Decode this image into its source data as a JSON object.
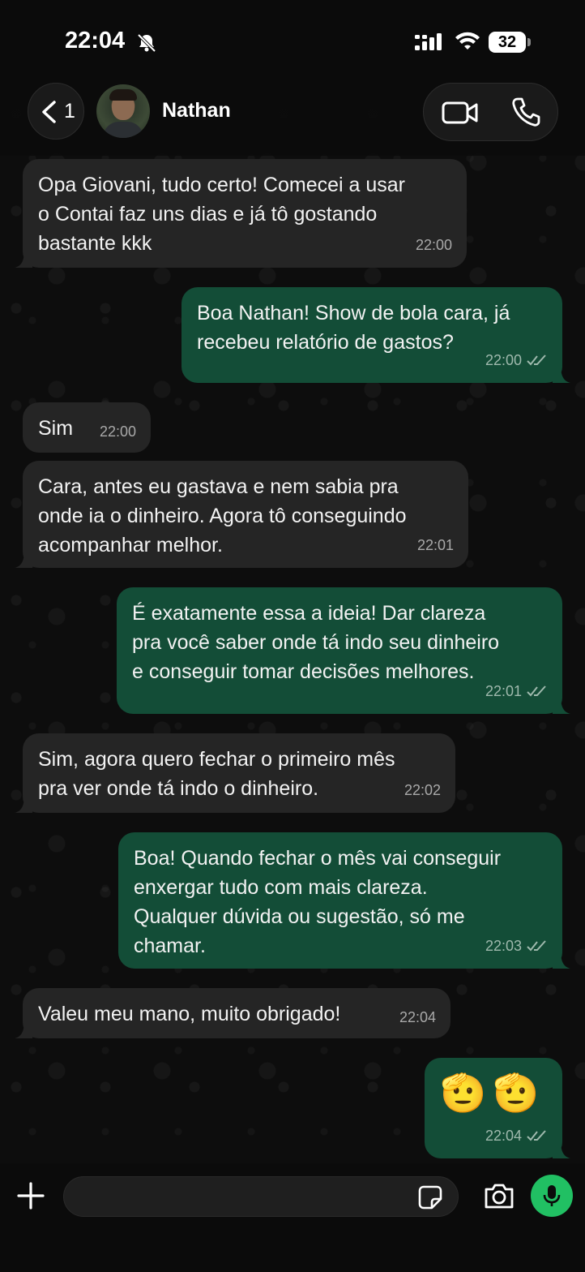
{
  "status_bar": {
    "time": "22:04",
    "battery": "32"
  },
  "header": {
    "back_count": "1",
    "contact_name": "Nathan"
  },
  "messages": [
    {
      "direction": "in",
      "text": "Opa Giovani, tudo certo! Comecei a usar\no Contai faz uns dias e já tô gostando\nbastante kkk",
      "time": "22:00"
    },
    {
      "direction": "out",
      "text": "Boa Nathan! Show de bola cara, já\nrecebeu relatório de gastos?",
      "time": "22:00",
      "read": true
    },
    {
      "direction": "in",
      "text": "Sim",
      "time": "22:00"
    },
    {
      "direction": "in",
      "text": "Cara, antes eu gastava e nem sabia pra\nonde ia o dinheiro. Agora tô conseguindo\nacompanhar melhor.",
      "time": "22:01"
    },
    {
      "direction": "out",
      "text": "É exatamente essa a ideia! Dar clareza\npra você saber onde tá indo seu dinheiro\ne conseguir tomar decisões melhores.",
      "time": "22:01",
      "read": true
    },
    {
      "direction": "in",
      "text": "Sim, agora quero fechar o primeiro mês\npra ver onde tá indo o dinheiro.",
      "time": "22:02"
    },
    {
      "direction": "out",
      "text": "Boa! Quando fechar o mês vai conseguir\nenxergar tudo com mais clareza.\nQualquer dúvida ou sugestão, só me\nchamar.",
      "time": "22:03",
      "read": true
    },
    {
      "direction": "in",
      "text": "Valeu meu mano, muito obrigado!",
      "time": "22:04"
    },
    {
      "direction": "out",
      "text": "🫡🫡",
      "time": "22:04",
      "read": true
    }
  ],
  "composer": {
    "value": "",
    "placeholder": ""
  },
  "colors": {
    "incoming_bubble": "#252525",
    "outgoing_bubble": "#134d37",
    "mic_button": "#21c063",
    "background": "#0b0b0b"
  },
  "icons": [
    "bell-off-icon",
    "signal-icon",
    "wifi-icon",
    "battery-icon",
    "chevron-left-icon",
    "video-call-icon",
    "phone-icon",
    "double-check-icon",
    "plus-icon",
    "sticker-icon",
    "camera-icon",
    "mic-icon"
  ]
}
